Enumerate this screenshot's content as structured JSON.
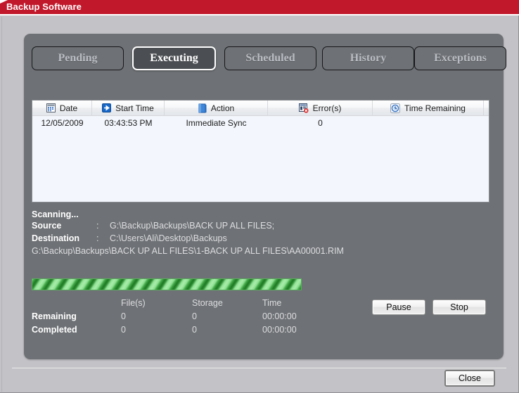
{
  "window": {
    "title": "Backup Software",
    "accent_color": "#c2182b",
    "panel_color": "#6e7175",
    "body_color": "#c3c3c7"
  },
  "tabs": [
    {
      "label": "Pending",
      "active": false
    },
    {
      "label": "Executing",
      "active": true
    },
    {
      "label": "Scheduled",
      "active": false
    },
    {
      "label": "History",
      "active": false
    },
    {
      "label": "Exceptions",
      "active": false
    }
  ],
  "list_view": {
    "columns": [
      {
        "label": "Date",
        "icon": "calendar-icon"
      },
      {
        "label": "Start Time",
        "icon": "blue-arrow-icon"
      },
      {
        "label": "Action",
        "icon": "blue-folder-icon"
      },
      {
        "label": "Error(s)",
        "icon": "error-report-icon"
      },
      {
        "label": "Time Remaining",
        "icon": "clock-icon"
      }
    ],
    "rows": [
      {
        "date": "12/05/2009",
        "start_time": "03:43:53 PM",
        "action": "Immediate Sync",
        "errors": "0",
        "time_remaining": ""
      }
    ]
  },
  "status": {
    "scanning_label": "Scanning...",
    "source_label": "Source",
    "source_value": "G:\\Backup\\Backups\\BACK UP ALL FILES;",
    "destination_label": "Destination",
    "destination_value": "C:\\Users\\Ali\\Desktop\\Backups",
    "colon": ":",
    "current_file": "G:\\Backup\\Backups\\BACK UP ALL FILES\\1-BACK UP ALL FILES\\AA00001.RIM"
  },
  "progress": {
    "style": "marquee",
    "fill_color": "#9fe6a3",
    "stripe_color": "#1f7a24"
  },
  "stats": {
    "headers": {
      "files": "File(s)",
      "storage": "Storage",
      "time": "Time"
    },
    "remaining": {
      "label": "Remaining",
      "files": "0",
      "storage": "0",
      "time": "00:00:00"
    },
    "completed": {
      "label": "Completed",
      "files": "0",
      "storage": "0",
      "time": "00:00:00"
    }
  },
  "buttons": {
    "pause": "Pause",
    "stop": "Stop",
    "close": "Close"
  }
}
